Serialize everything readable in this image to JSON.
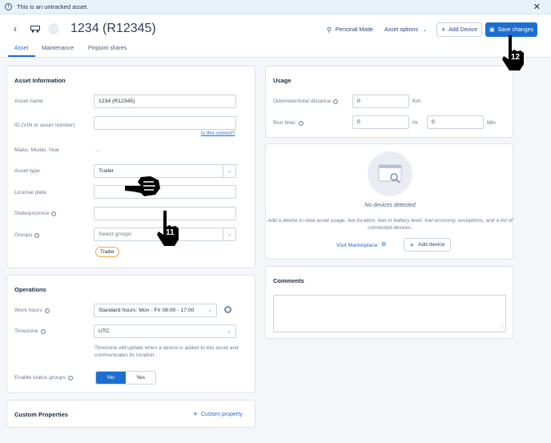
{
  "banner": {
    "text": "This is an untracked asset."
  },
  "header": {
    "title": "1234 (R12345)",
    "personal_mode": "Personal Mode",
    "asset_options": "Asset options",
    "add_device": "Add Device",
    "save_changes": "Save changes"
  },
  "tabs": [
    "Asset",
    "Maintenance",
    "Pinpoint shares"
  ],
  "asset_info": {
    "title": "Asset Information",
    "asset_name_label": "Asset name",
    "asset_name_value": "1234 (R12345)",
    "id_label": "ID (VIN or asset number)",
    "id_value": "",
    "is_this_correct": "Is this correct?",
    "make_label": "Make, Model, Year",
    "make_value": "...",
    "type_label": "Asset type",
    "type_value": "Trailer",
    "plate_label": "License plate",
    "plate_value": "",
    "state_label": "State/province",
    "state_value": "",
    "groups_label": "Groups",
    "groups_placeholder": "Select groups",
    "group_chip": "Trailer"
  },
  "operations": {
    "title": "Operations",
    "work_hours_label": "Work hours",
    "work_hours_value": "Standard hours: Mon - Fri 08:00 - 17:00",
    "timezone_label": "Timezone",
    "timezone_value": "UTC",
    "timezone_note": "Timezone will update when a device is added to this asset and communicates its location.",
    "status_groups_label": "Enable status groups",
    "no": "No",
    "yes": "Yes"
  },
  "custom": {
    "title": "Custom Properties",
    "add": "Custom property"
  },
  "usage": {
    "title": "Usage",
    "odometer_label": "Odometer/total distance",
    "odometer_value": "0",
    "odometer_unit": "Km",
    "runtime_label": "Run time:",
    "runtime_hr": "0",
    "hr_unit": "Hr",
    "runtime_min": "0",
    "min_unit": "Min"
  },
  "devices": {
    "none": "No devices detected",
    "desc": "Add a device to view asset usage, live location, fuel or battery level, fuel economy, exceptions, and a list of connected devices.",
    "marketplace": "Visit Marketplace",
    "add_device": "Add device"
  },
  "comments": {
    "title": "Comments"
  },
  "cursors": [
    "12",
    "11"
  ],
  "colors": {
    "accent": "#1d6ed1",
    "chip_border": "#f0a64a"
  }
}
